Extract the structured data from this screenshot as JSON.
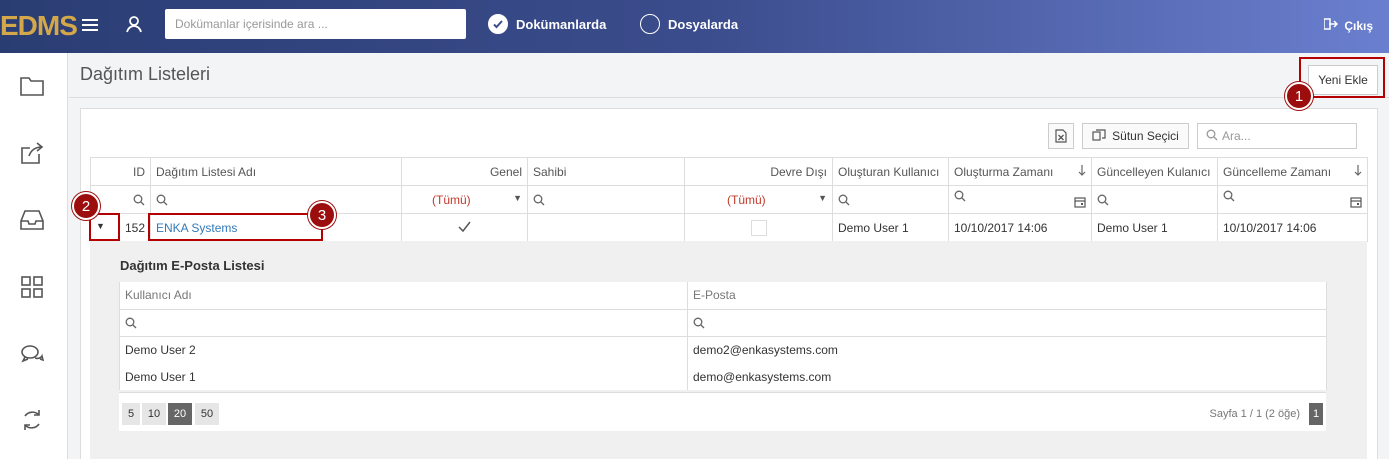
{
  "app": {
    "logo": "EDMS"
  },
  "header": {
    "search_placeholder": "Dokümanlar içerisinde ara ...",
    "radio_documents": "Dokümanlarda",
    "radio_files": "Dosyalarda",
    "logout": "Çıkış"
  },
  "page": {
    "title": "Dağıtım Listeleri",
    "new_button": "Yeni Ekle"
  },
  "toolbar": {
    "column_chooser": "Sütun Seçici",
    "search_placeholder": "Ara..."
  },
  "grid": {
    "columns": [
      "ID",
      "Dağıtım Listesi Adı",
      "Genel",
      "Sahibi",
      "Devre Dışı",
      "Oluşturan Kullanıcı",
      "Oluşturma Zamanı",
      "Güncelleyen Kulanıcı",
      "Güncelleme Zamanı"
    ],
    "filter_all": "(Tümü)",
    "row": {
      "id": "152",
      "name": "ENKA Systems",
      "created_by": "Demo User 1",
      "created_at": "10/10/2017 14:06",
      "updated_by": "Demo User 1",
      "updated_at": "10/10/2017 14:06"
    }
  },
  "detail": {
    "title": "Dağıtım E-Posta Listesi",
    "columns": [
      "Kullanıcı Adı",
      "E-Posta"
    ],
    "rows": [
      {
        "user": "Demo User 2",
        "email": "demo2@enkasystems.com"
      },
      {
        "user": "Demo User 1",
        "email": "demo@enkasystems.com"
      }
    ],
    "page_sizes": [
      "5",
      "10",
      "20",
      "50"
    ],
    "page_info": "Sayfa 1 / 1 (2 öğe)",
    "current_page": "1"
  },
  "annotations": [
    "1",
    "2",
    "3"
  ],
  "colors": {
    "accent": "#9c0d0d",
    "link": "#337ab7",
    "filter_red": "#c0392b"
  }
}
